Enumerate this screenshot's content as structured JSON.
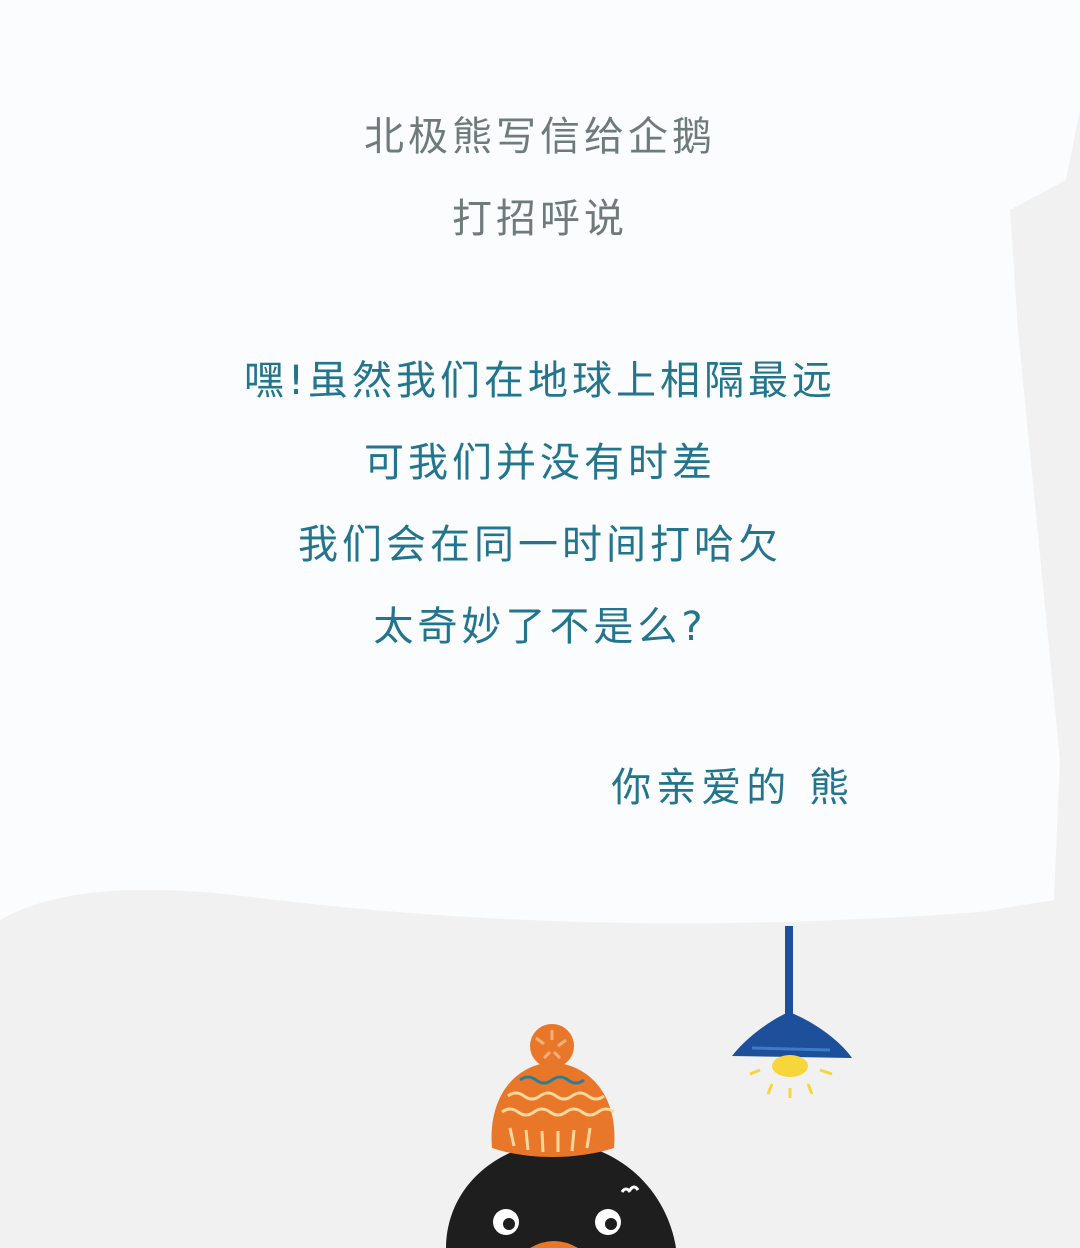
{
  "heading": {
    "line1": "北极熊写信给企鹅",
    "line2": "打招呼说"
  },
  "letter": {
    "lines": [
      "嘿!虽然我们在地球上相隔最远",
      "可我们并没有时差",
      "我们会在同一时间打哈欠",
      "太奇妙了不是么?"
    ],
    "signature": "你亲爱的 熊"
  },
  "colors": {
    "background": "#f1f1f1",
    "paper": "#fafcfd",
    "heading_text": "#6f7a7c",
    "letter_text": "#23748d",
    "hat_orange": "#e8772a",
    "penguin_black": "#1e1e1e",
    "lamp_blue": "#1d4f9a",
    "lamp_light": "#f6d63a"
  },
  "illustration": {
    "penguin": "penguin-with-knit-hat",
    "lamp": "hanging-lamp"
  }
}
